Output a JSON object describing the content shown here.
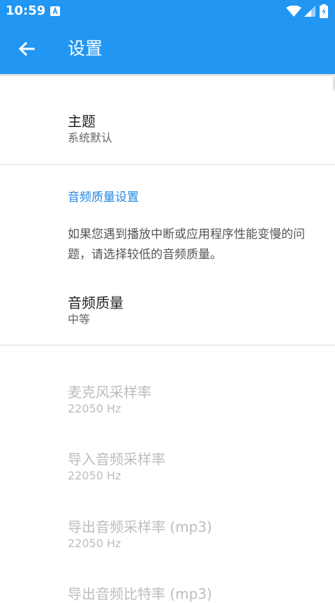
{
  "status_bar": {
    "time": "10:59"
  },
  "app_bar": {
    "title": "设置"
  },
  "prefs": {
    "theme": {
      "title": "主题",
      "summary": "系统默认"
    },
    "audio_category": "音频质量设置",
    "audio_desc": "如果您遇到播放中断或应用程序性能变慢的问题，请选择较低的音频质量。",
    "audio_quality": {
      "title": "音频质量",
      "summary": "中等"
    },
    "mic_rate": {
      "title": "麦克风采样率",
      "summary": "22050 Hz"
    },
    "import_rate": {
      "title": "导入音频采样率",
      "summary": "22050 Hz"
    },
    "export_rate": {
      "title": "导出音频采样率 (mp3)",
      "summary": "22050 Hz"
    },
    "export_bitrate": {
      "title": "导出音频比特率 (mp3)"
    }
  },
  "colors": {
    "primary": "#2196F3",
    "accent": "#1E88E5",
    "disabled_text": "#bdbdbd"
  }
}
